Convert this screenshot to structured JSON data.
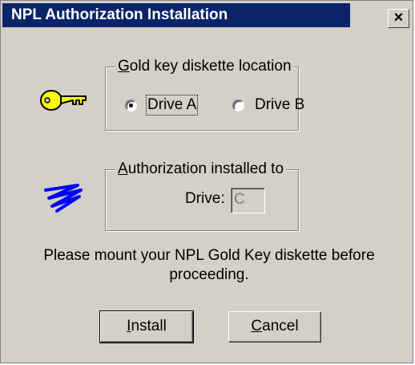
{
  "window": {
    "title": "NPL Authorization Installation",
    "close_glyph": "×"
  },
  "location_group": {
    "legend_hotkey": "G",
    "legend_rest": "old key diskette location",
    "options": [
      {
        "label": "Drive A",
        "checked": true
      },
      {
        "label": "Drive B",
        "checked": false
      }
    ]
  },
  "installed_group": {
    "legend_hotkey": "A",
    "legend_rest": "uthorization installed to",
    "drive_label": "Drive:",
    "drive_value": "C"
  },
  "message": "Please mount your NPL Gold Key diskette before proceeding.",
  "buttons": {
    "install_hotkey": "I",
    "install_rest": "nstall",
    "cancel_hotkey": "C",
    "cancel_rest": "ancel"
  },
  "icons": {
    "key": "key-icon",
    "scribble": "blue-scribble-icon"
  },
  "colors": {
    "title_bar": "#0a246a",
    "face": "#d4d0c8",
    "key": "#ffff00",
    "scribble": "#0000ff"
  }
}
